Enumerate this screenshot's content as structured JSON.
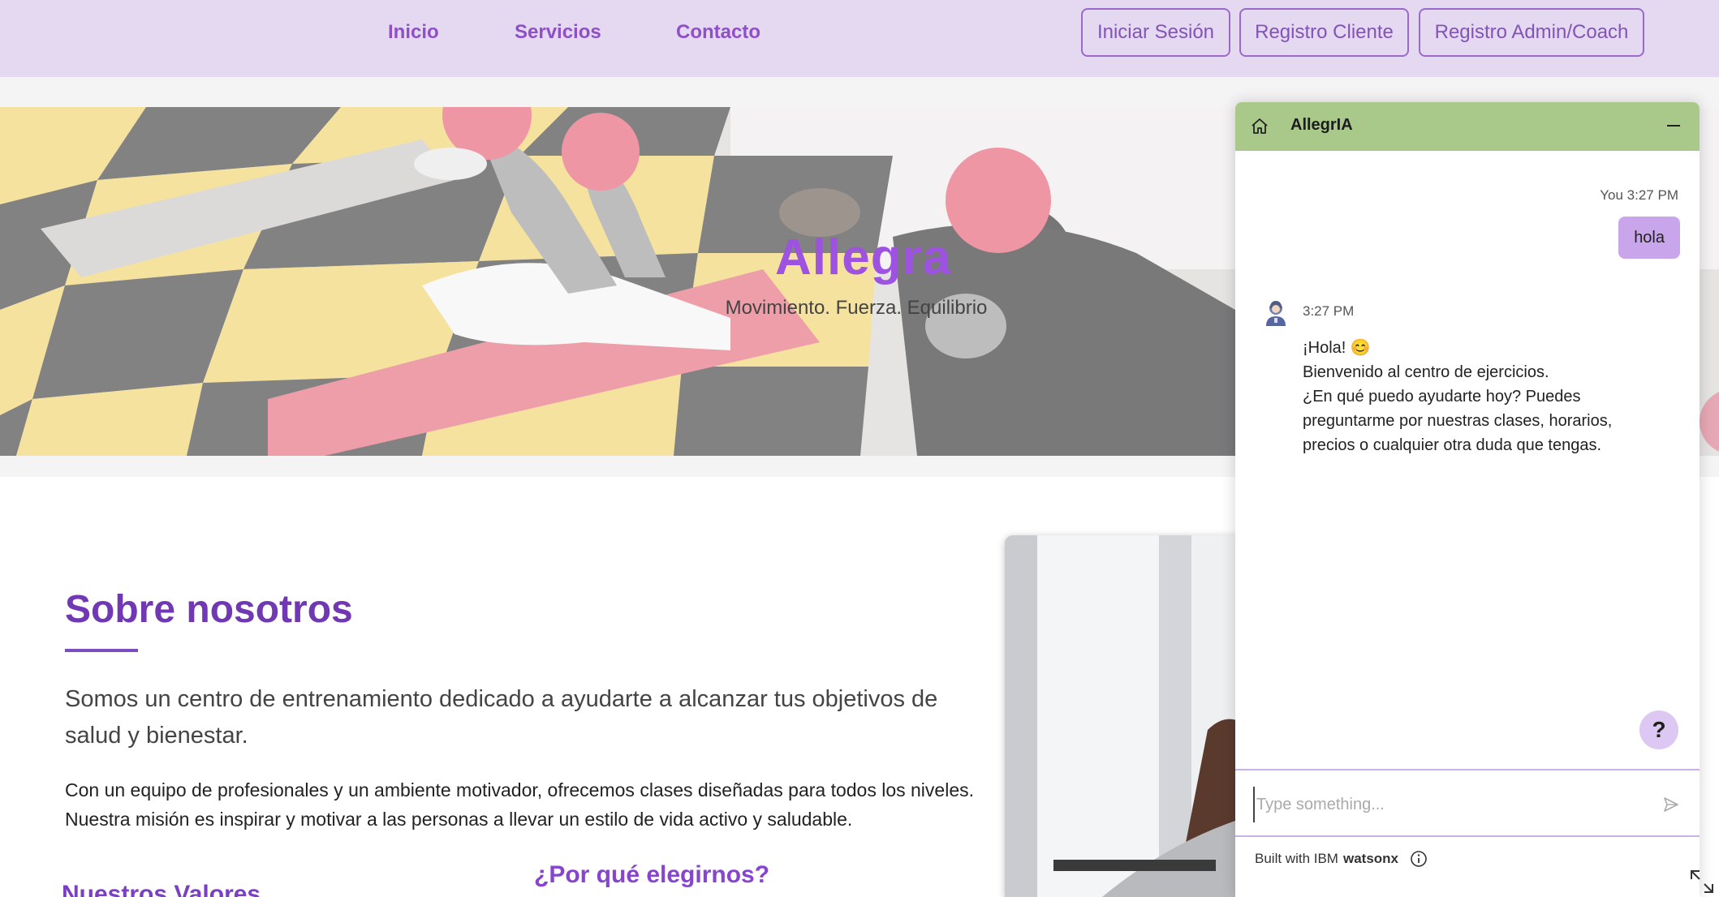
{
  "nav": {
    "links": [
      "Inicio",
      "Servicios",
      "Contacto"
    ],
    "buttons": [
      "Iniciar Sesión",
      "Registro Cliente",
      "Registro Admin/Coach"
    ]
  },
  "hero": {
    "title": "Allegra",
    "subtitle": "Movimiento. Fuerza. Equilibrio"
  },
  "about": {
    "title": "Sobre nosotros",
    "lead": "Somos un centro de entrenamiento dedicado a ayudarte a alcanzar tus objetivos de salud y bienestar.",
    "body": "Con un equipo de profesionales y un ambiente motivador, ofrecemos clases diseñadas para todos los niveles. Nuestra misión es inspirar y motivar a las personas a llevar un estilo de vida activo y saludable.",
    "values_title": "Nuestros Valores",
    "why_title": "¿Por qué elegirnos?"
  },
  "chat": {
    "name": "AllegrIA",
    "user_meta": "You 3:27 PM",
    "user_message": "hola",
    "bot_meta": "3:27 PM",
    "bot_lines": [
      "¡Hola! 😊",
      "Bienvenido al centro de ejercicios.",
      "¿En qué puedo ayudarte hoy? Puedes preguntarme por nuestras clases, horarios, precios o cualquier otra duda que tengas."
    ],
    "help_label": "?",
    "input_placeholder": "Type something...",
    "footer_prefix": "Built with IBM",
    "footer_brand": "watsonx"
  },
  "icons": {
    "home": "home-icon",
    "minimize": "minimize-icon",
    "send": "send-icon",
    "info": "info-icon",
    "expand": "expand-icon",
    "avatar": "bot-avatar-icon"
  },
  "colors": {
    "nav_bg": "#e4d9f1",
    "brand_purple": "#8e4fc7",
    "chat_header": "#a9c98a",
    "user_bubble": "#c9a6ec"
  }
}
